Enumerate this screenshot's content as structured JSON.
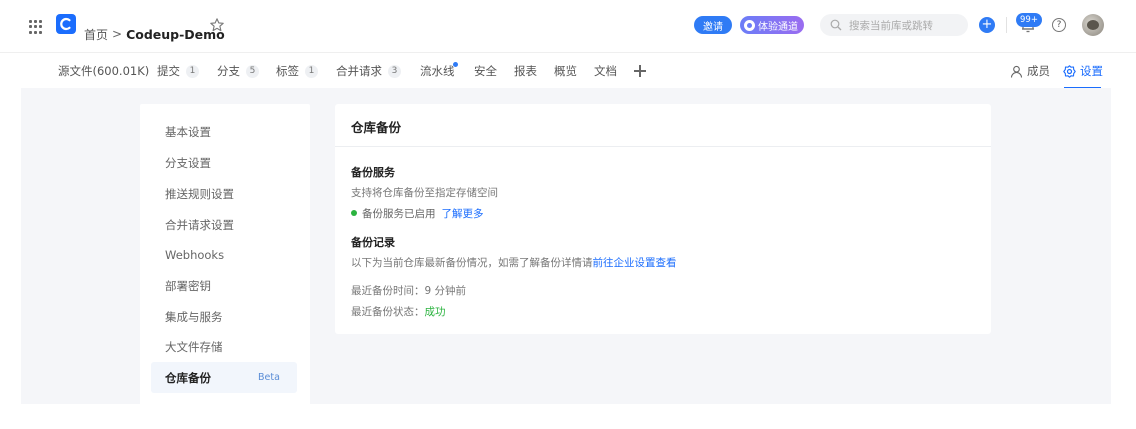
{
  "header": {
    "breadcrumb_home": "首页",
    "breadcrumb_sep": ">",
    "repo_name": "Codeup-Demo",
    "invite_label": "邀请",
    "try_label": "体验通道",
    "search_placeholder": "搜索当前库或跳转",
    "notifications_badge": "99+",
    "help_glyph": "?",
    "add_glyph": "+"
  },
  "tabs": [
    {
      "label": "源文件(600.01K)"
    },
    {
      "label": "提交",
      "count": "1"
    },
    {
      "label": "分支",
      "count": "5"
    },
    {
      "label": "标签",
      "count": "1"
    },
    {
      "label": "合并请求",
      "count": "3"
    },
    {
      "label": "流水线"
    },
    {
      "label": "安全"
    },
    {
      "label": "报表"
    },
    {
      "label": "概览"
    },
    {
      "label": "文档"
    }
  ],
  "right_tabs": {
    "members": "成员",
    "settings": "设置"
  },
  "sidebar": {
    "items": [
      {
        "label": "基本设置"
      },
      {
        "label": "分支设置"
      },
      {
        "label": "推送规则设置"
      },
      {
        "label": "合并请求设置"
      },
      {
        "label": "Webhooks"
      },
      {
        "label": "部署密钥"
      },
      {
        "label": "集成与服务"
      },
      {
        "label": "大文件存储"
      },
      {
        "label": "仓库备份",
        "badge": "Beta"
      }
    ]
  },
  "panel": {
    "title": "仓库备份",
    "service_title": "备份服务",
    "service_desc": "支持将仓库备份至指定存储空间",
    "service_status": "备份服务已启用",
    "learn_more": "了解更多",
    "records_title": "备份记录",
    "records_desc": "以下为当前仓库最新备份情况，如需了解备份详情请",
    "records_link": "前往企业设置查看",
    "last_time_label": "最近备份时间：",
    "last_time_value": "9 分钟前",
    "last_status_label": "最近备份状态：",
    "last_status_value": "成功"
  },
  "colors": {
    "accent": "#1b6dfd",
    "success": "#2bb33f"
  }
}
